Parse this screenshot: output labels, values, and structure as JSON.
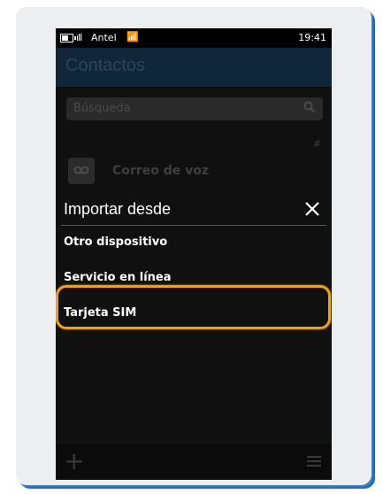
{
  "status_bar": {
    "carrier": "Antel",
    "time": "19:41",
    "signal_icon": "signal-bars-icon",
    "wifi_icon": "wifi-icon",
    "battery_icon": "battery-icon"
  },
  "app_header": {
    "title": "Contactos"
  },
  "search": {
    "placeholder": "Búsqueda"
  },
  "index_letter": "#",
  "voicemail": {
    "label": "Correo de voz",
    "icon": "voicemail-icon"
  },
  "import_dialog": {
    "title": "Importar desde",
    "close_icon": "close-icon",
    "options": [
      "Otro dispositivo",
      "Servicio en línea",
      "Tarjeta SIM"
    ],
    "highlighted_option": "Tarjeta SIM",
    "highlight_color": "#f0a30a"
  },
  "bottom_bar": {
    "add_icon": "plus-icon",
    "menu_icon": "hamburger-menu-icon"
  }
}
